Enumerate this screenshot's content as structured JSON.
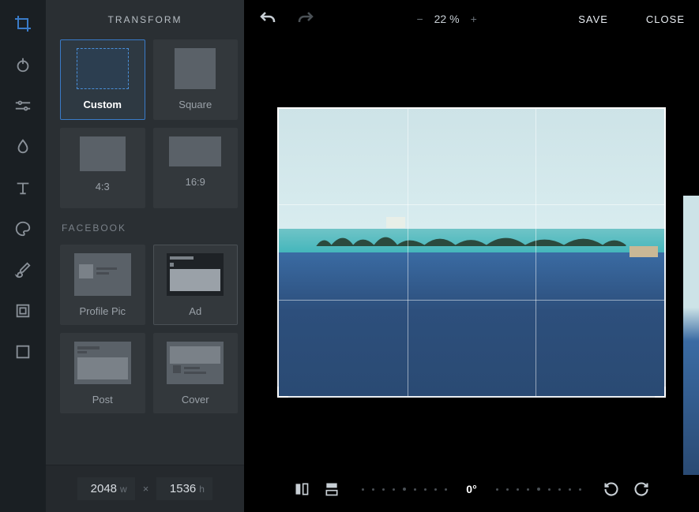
{
  "header": {
    "title": "TRANSFORM"
  },
  "topbar": {
    "zoom_pct": "22 %",
    "save_label": "SAVE",
    "close_label": "CLOSE"
  },
  "presets": {
    "basic": [
      {
        "label": "Custom",
        "selected": true
      },
      {
        "label": "Square",
        "selected": false
      },
      {
        "label": "4:3",
        "selected": false
      },
      {
        "label": "16:9",
        "selected": false
      }
    ],
    "facebook_label": "FACEBOOK",
    "facebook": [
      {
        "label": "Profile Pic"
      },
      {
        "label": "Ad"
      },
      {
        "label": "Post"
      },
      {
        "label": "Cover"
      }
    ]
  },
  "dimensions": {
    "width": "2048",
    "height": "1536",
    "w_unit": "w",
    "h_unit": "h"
  },
  "rotation": {
    "angle": "0°"
  },
  "rail_icons": [
    "crop",
    "adjust",
    "sliders",
    "droplet",
    "type",
    "brush",
    "paint",
    "frame",
    "resize"
  ]
}
